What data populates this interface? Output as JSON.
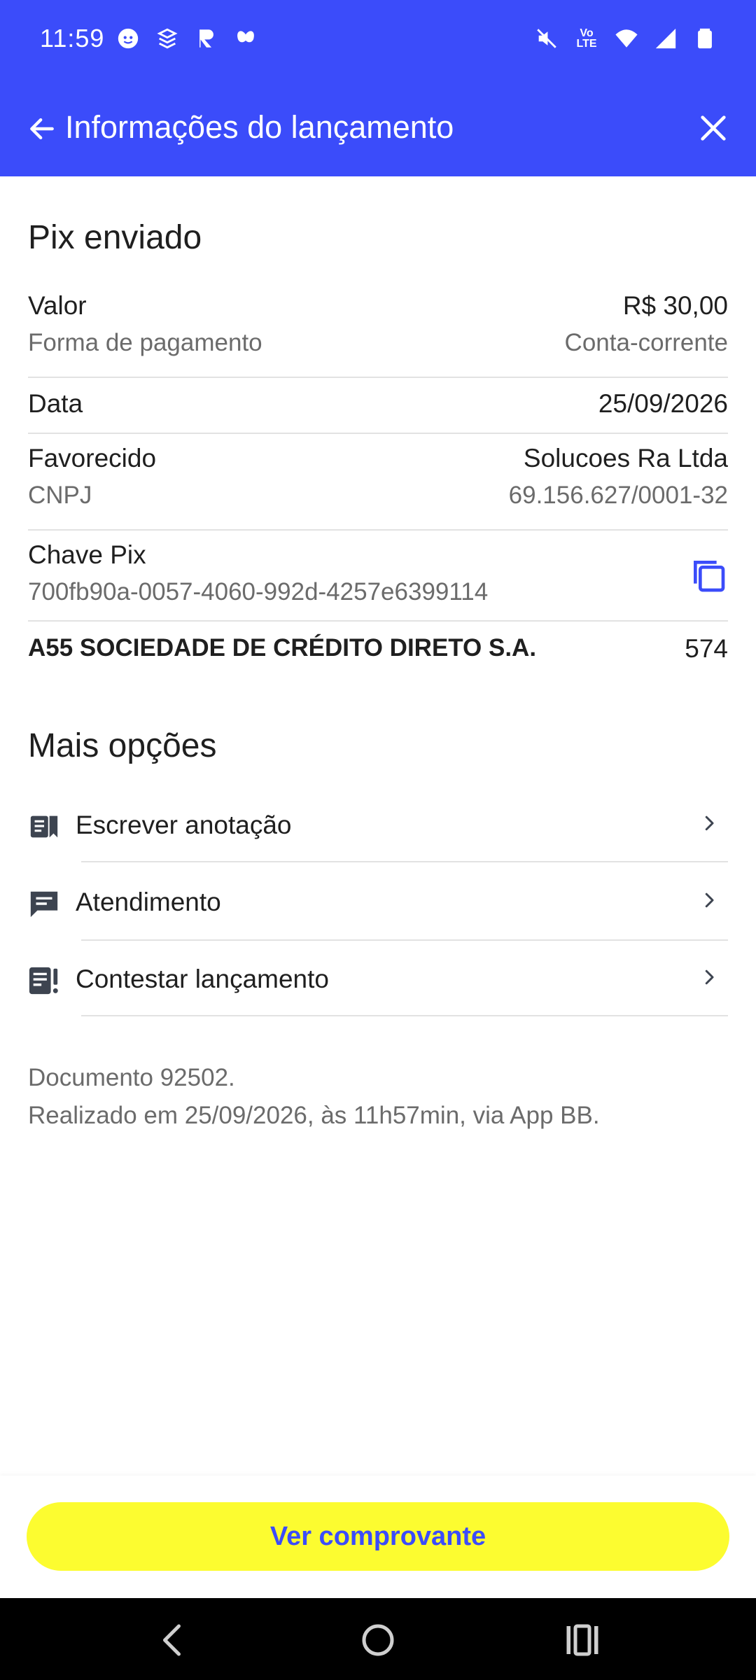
{
  "status_bar": {
    "time": "11:59",
    "left_icons": [
      "face-icon",
      "layers-icon",
      "r-logo-icon",
      "butterfly-icon"
    ],
    "right_icons": [
      "mute-icon",
      "volte-icon",
      "wifi-icon",
      "signal-icon",
      "battery-icon"
    ],
    "volte_text": "Vo LTE"
  },
  "app_bar": {
    "title": "Informações do lançamento",
    "color": "#3b4cfa"
  },
  "transaction": {
    "title": "Pix enviado",
    "valor_label": "Valor",
    "valor_value": "R$ 30,00",
    "forma_label": "Forma de pagamento",
    "forma_value": "Conta-corrente",
    "data_label": "Data",
    "data_value": "25/09/2026",
    "favorecido_label": "Favorecido",
    "favorecido_value": "Solucoes Ra Ltda",
    "cnpj_label": "CNPJ",
    "cnpj_value": "69.156.627/0001-32",
    "chave_label": "Chave Pix",
    "chave_value": "700fb90a-0057-4060-992d-4257e6399114",
    "bank_name": "A55 SOCIEDADE DE CRÉDITO DIRETO S.A.",
    "bank_code": "574"
  },
  "more_options": {
    "title": "Mais opções",
    "items": [
      {
        "label": "Escrever anotação",
        "icon": "note-icon"
      },
      {
        "label": "Atendimento",
        "icon": "chat-icon"
      },
      {
        "label": "Contestar lançamento",
        "icon": "contest-icon"
      }
    ]
  },
  "footer_note": {
    "line1": "Documento 92502.",
    "line2": "Realizado em 25/09/2026, às 11h57min, via App BB."
  },
  "cta": {
    "label": "Ver comprovante",
    "background": "#fcfc30",
    "text_color": "#3b4cfa"
  }
}
